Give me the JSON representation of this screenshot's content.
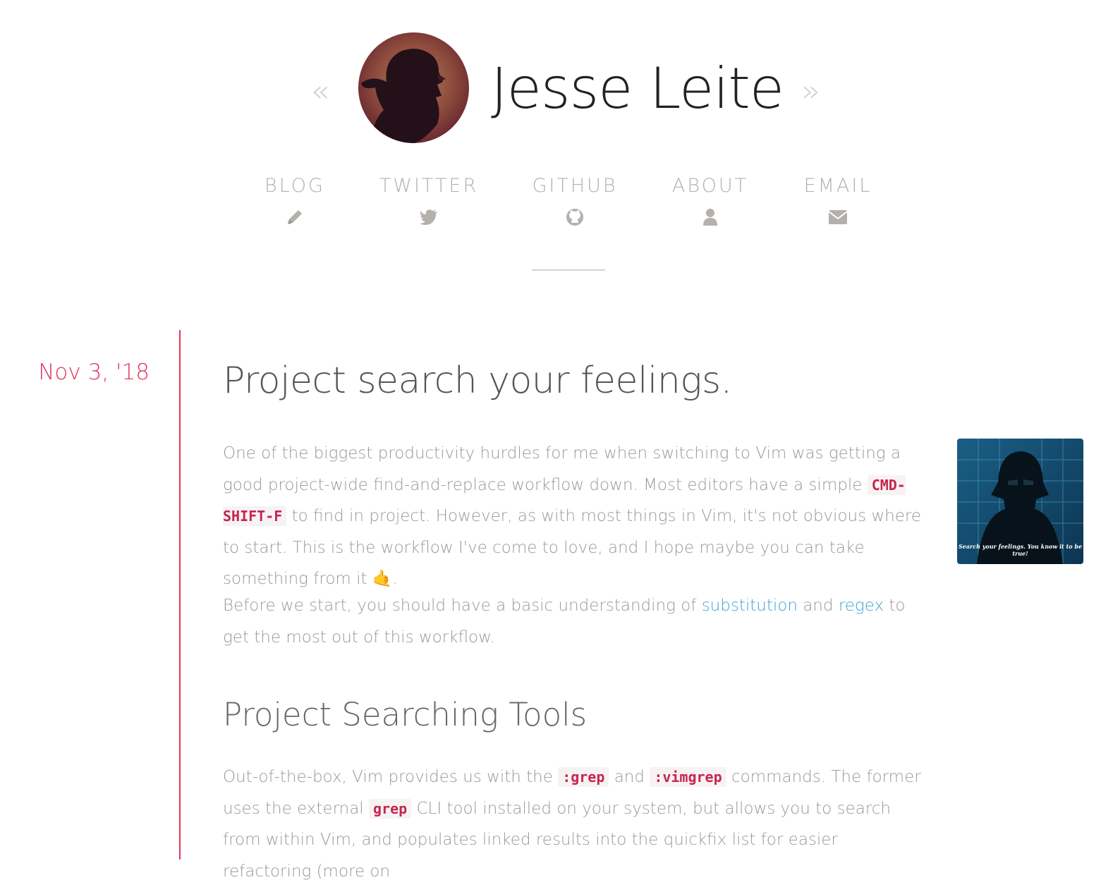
{
  "header": {
    "prev_arrow": "«",
    "next_arrow": "»",
    "site_title": "Jesse Leite"
  },
  "nav": [
    {
      "label": "BLOG",
      "icon": "pencil-icon"
    },
    {
      "label": "TWITTER",
      "icon": "twitter-icon"
    },
    {
      "label": "GITHUB",
      "icon": "github-icon"
    },
    {
      "label": "ABOUT",
      "icon": "user-icon"
    },
    {
      "label": "EMAIL",
      "icon": "envelope-icon"
    }
  ],
  "post": {
    "date": "Nov 3, '18",
    "title": "Project search your feelings.",
    "p1": {
      "t1": "One of the biggest productivity hurdles for me when switching to Vim was getting a good project-wide find-and-replace workflow down. Most editors have a simple ",
      "code1": "CMD-SHIFT-F",
      "t2": " to find in project. However, as with most things in Vim, it's not obvious where to start. This is the workflow I've come to love, and I hope maybe you can take something from it ",
      "emoji": "🤙",
      "t3": "."
    },
    "p2": {
      "t1": "Before we start, you should have a basic understanding of ",
      "link1": "substitution",
      "t2": " and ",
      "link2": "regex",
      "t3": " to get the most out of this workflow."
    },
    "section_heading": "Project Searching Tools",
    "p3": {
      "t1": "Out-of-the-box, Vim provides us with the ",
      "code1": ":grep",
      "t2": " and ",
      "code2": ":vimgrep",
      "t3": " commands. The former uses the external ",
      "code3": "grep",
      "t4": " CLI tool installed on your system, but allows you to search from within Vim, and populates linked results into the quickfix list for easier refactoring (more on"
    },
    "thumbnail_caption": "Search your feelings. You know it to be true!"
  },
  "colors": {
    "accent": "#e2365f",
    "link": "#3ba6cf",
    "code": "#c7254e",
    "nav": "#b4b0ac"
  }
}
